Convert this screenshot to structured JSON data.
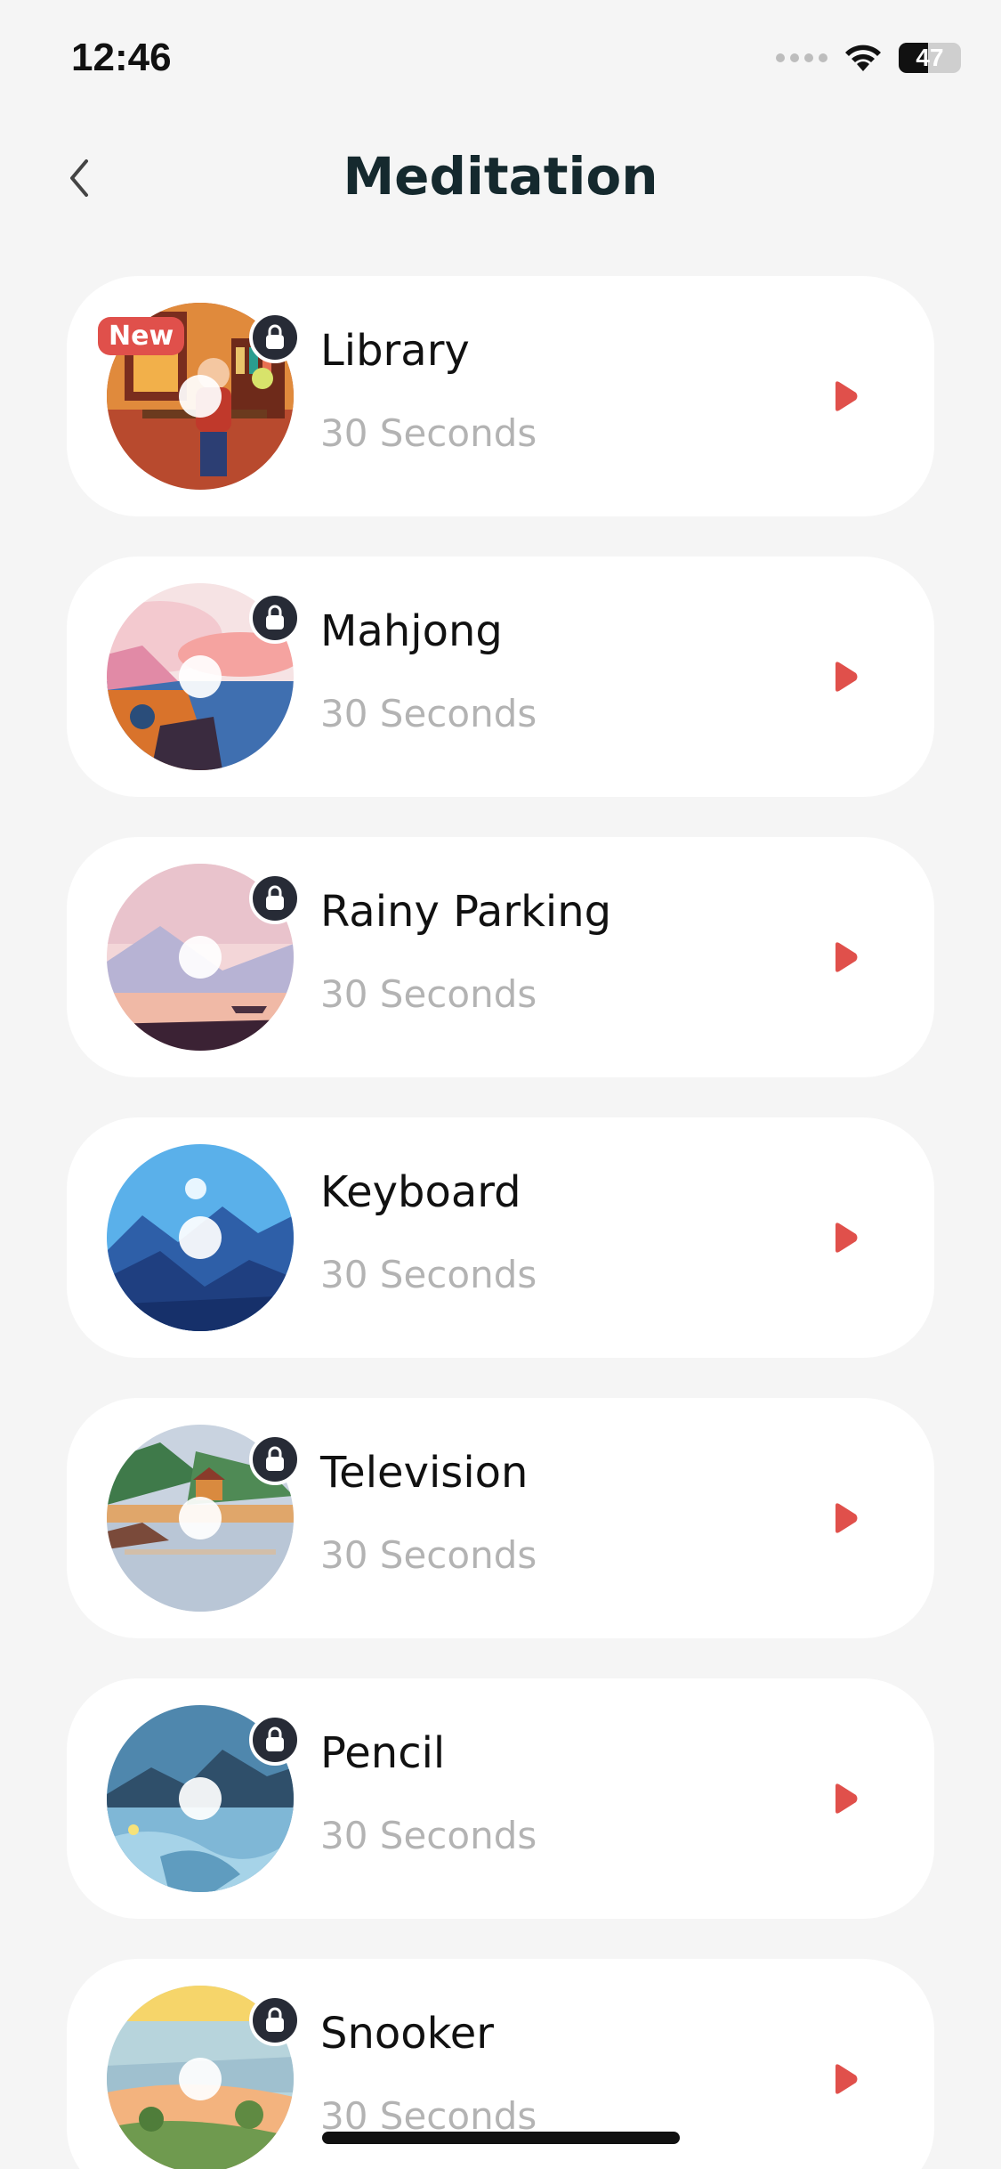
{
  "status_bar": {
    "time": "12:46",
    "battery_text": "47",
    "battery_level": 0.47
  },
  "header": {
    "title": "Meditation"
  },
  "items": [
    {
      "title": "Library",
      "subtitle": "30 Seconds",
      "badge": "New",
      "locked": true,
      "art": "library-scene"
    },
    {
      "title": "Mahjong",
      "subtitle": "30 Seconds",
      "locked": true,
      "art": "seaside-sunset"
    },
    {
      "title": "Rainy Parking",
      "subtitle": "30 Seconds",
      "locked": true,
      "art": "pink-lake"
    },
    {
      "title": "Keyboard",
      "subtitle": "30 Seconds",
      "locked": false,
      "art": "blue-mountains"
    },
    {
      "title": "Television",
      "subtitle": "30 Seconds",
      "locked": true,
      "art": "village-lake"
    },
    {
      "title": "Pencil",
      "subtitle": "30 Seconds",
      "locked": true,
      "art": "night-river"
    },
    {
      "title": "Snooker",
      "subtitle": "30 Seconds",
      "locked": true,
      "art": "sunny-hills"
    }
  ],
  "colors": {
    "accent": "#e0504b",
    "lock": "#272b36",
    "card": "#ffffff",
    "background": "#f5f5f5"
  }
}
